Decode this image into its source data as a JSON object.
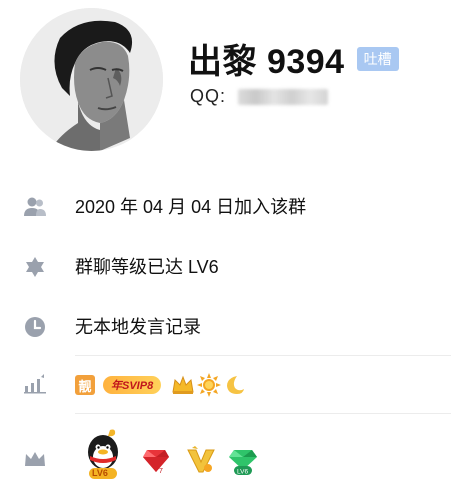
{
  "profile": {
    "name": "出黎 9394",
    "tag": "吐槽",
    "qq_label": "QQ:"
  },
  "info_rows": [
    {
      "icon": "group-icon",
      "text": "2020 年 04 月 04 日加入该群"
    },
    {
      "icon": "star-of-david-icon",
      "text": "群聊等级已达 LV6"
    },
    {
      "icon": "clock-icon",
      "text": "无本地发言记录"
    }
  ],
  "level_badges": {
    "icon": "rank-icon",
    "liang": "靓",
    "svip": "年SVIP8",
    "extra": [
      "crown-icon",
      "sun-icon",
      "moon-icon"
    ]
  },
  "honor_badges": {
    "icon": "honor-crown-icon",
    "qq_level_label": "LV6",
    "items": [
      "qq-penguin-level-icon",
      "red-diamond-icon",
      "gold-v-icon",
      "green-diamond-icon"
    ]
  },
  "colors": {
    "tag_bg": "#a9c8f2",
    "icon_gray": "#9aa1ad",
    "svip_gold": "#ffc04a",
    "svip_text": "#c0141c"
  }
}
